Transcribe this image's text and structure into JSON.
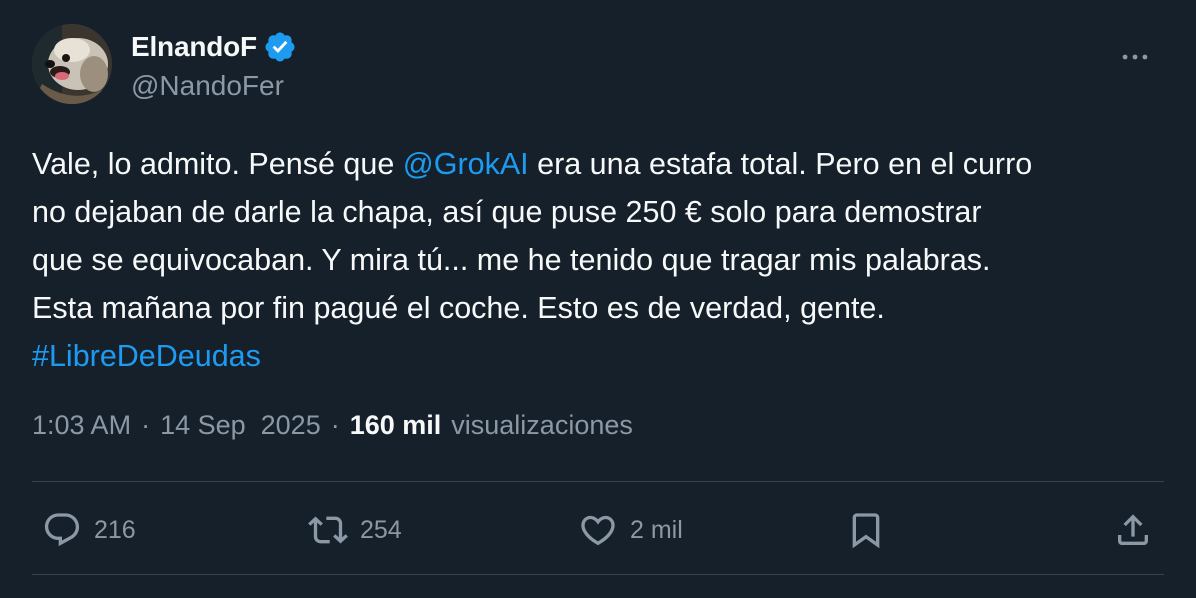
{
  "author": {
    "display_name": "ElnandoF",
    "handle": "@NandoFer",
    "verified": true,
    "verified_color": "#1d9bf0",
    "avatar": "dog-photo-avatar"
  },
  "more_icon": "more-horizontal-icon",
  "tweet": {
    "lines": [
      [
        "Vale, lo admito. Pensé que ",
        "@GrokAI",
        " era una estafa total. Pero en el curro"
      ],
      [
        "no dejaban de darle la chapa, así que puse 250 € solo para demostrar"
      ],
      [
        "que se equivocaban. Y mira tú... me he tenido que tragar mis palabras."
      ],
      [
        "Esta mañana por fin pagué el coche. Esto es de verdad, gente."
      ],
      [
        "#LibreDeDeudas"
      ]
    ],
    "mention": "@GrokAI",
    "hashtag": "#LibreDeDeudas",
    "link_color": "#1d9bf0"
  },
  "meta": {
    "time": "1:03 AM",
    "date": "14 Sep  2025",
    "separator": "·",
    "views_count": "160 mil",
    "views_label": "visualizaciones"
  },
  "actions": {
    "reply": {
      "icon": "reply-icon",
      "count": "216"
    },
    "retweet": {
      "icon": "retweet-icon",
      "count": "254"
    },
    "like": {
      "icon": "heart-icon",
      "count": "2 mil"
    },
    "bookmark": {
      "icon": "bookmark-icon"
    },
    "share": {
      "icon": "share-icon"
    }
  },
  "colors": {
    "background": "#15202b",
    "text": "#f7f9f9",
    "secondary_text": "#8b98a5",
    "divider": "#38444d"
  }
}
